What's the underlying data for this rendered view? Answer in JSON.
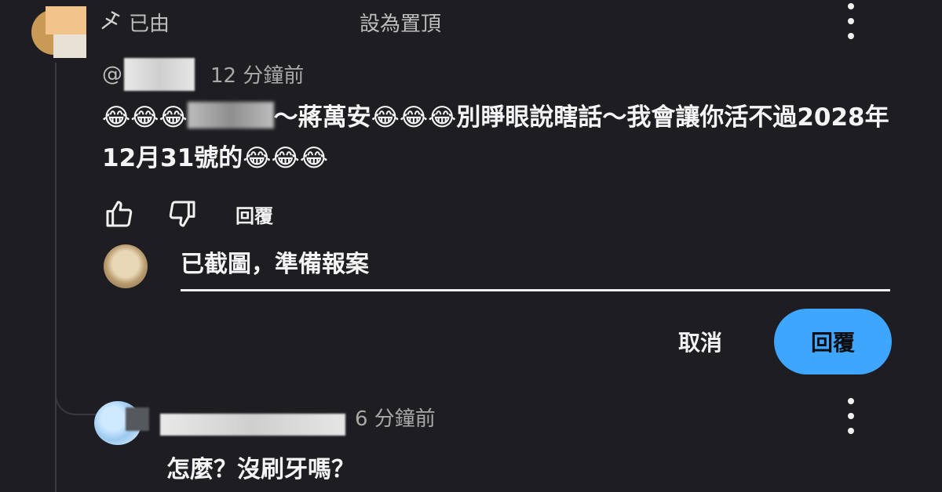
{
  "pinned": {
    "prefix": "已由",
    "suffix": "設為置頂",
    "icon": "pin-icon"
  },
  "comment": {
    "at_symbol": "@",
    "time": "12 分鐘前",
    "text_part1": "😂😂😂",
    "text_part2": "～蔣萬安😂😂😂別睜眼說瞎話～我會讓你活不過2028年12月31號的😂😂😂",
    "actions": {
      "like_icon": "thumbs-up-icon",
      "dislike_icon": "thumbs-down-icon",
      "reply_label": "回覆"
    }
  },
  "reply_box": {
    "value": "已截圖，準備報案",
    "cancel_label": "取消",
    "submit_label": "回覆"
  },
  "reply_comment": {
    "time": "6 分鐘前",
    "text": "怎麼？沒刷牙嗎？"
  },
  "colors": {
    "background": "#1e1d21",
    "accent": "#3ea6ff",
    "text": "#f4f4f4",
    "muted": "#a9a9a9"
  }
}
